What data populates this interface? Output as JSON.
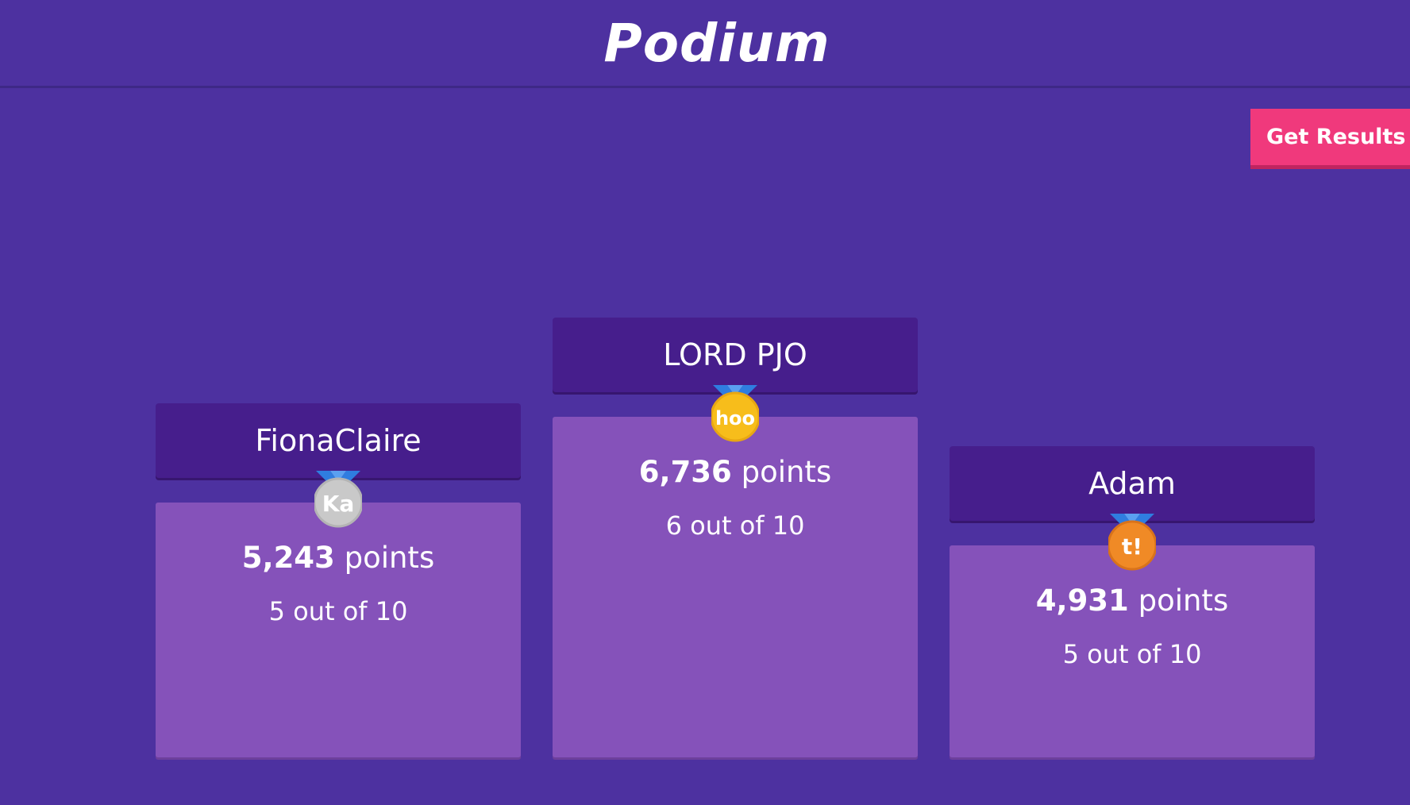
{
  "header": {
    "title": "Podium"
  },
  "actions": {
    "get_results_label": "Get Results"
  },
  "podium": [
    {
      "place": 2,
      "name": "FionaClaire",
      "points_value": "5,243",
      "points_unit": "points",
      "score": "5 out of 10",
      "medal": {
        "icon": "silver-medal-icon",
        "label": "Ka",
        "color": "#c9c9c9",
        "ribbon": "#2f7de0"
      }
    },
    {
      "place": 1,
      "name": "LORD PJO",
      "points_value": "6,736",
      "points_unit": "points",
      "score": "6 out of 10",
      "medal": {
        "icon": "gold-medal-icon",
        "label": "hoo",
        "color": "#f7bd1b",
        "ribbon": "#2f7de0"
      }
    },
    {
      "place": 3,
      "name": "Adam",
      "points_value": "4,931",
      "points_unit": "points",
      "score": "5 out of 10",
      "medal": {
        "icon": "bronze-medal-icon",
        "label": "t!",
        "color": "#f08a26",
        "ribbon": "#2f7de0"
      }
    }
  ],
  "colors": {
    "background": "#4d31a0",
    "nameplate": "#461e8c",
    "block": "#8552ba",
    "accent_button": "#f0397c"
  }
}
